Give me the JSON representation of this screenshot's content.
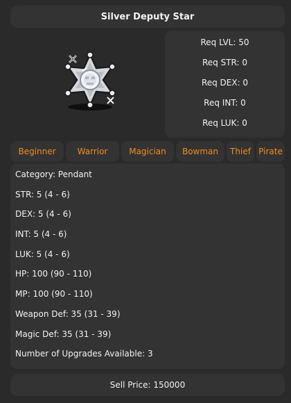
{
  "item": {
    "name": "Silver Deputy Star",
    "icon": "silver-star-badge-icon"
  },
  "requirements": [
    "Req LVL: 50",
    "Req STR: 0",
    "Req DEX: 0",
    "Req INT: 0",
    "Req LUK: 0"
  ],
  "jobs": [
    "Beginner",
    "Warrior",
    "Magician",
    "Bowman",
    "Thief",
    "Pirate"
  ],
  "stats": [
    "Category: Pendant",
    "STR: 5 (4 - 6)",
    "DEX: 5 (4 - 6)",
    "INT: 5 (4 - 6)",
    "LUK: 5 (4 - 6)",
    "HP: 100 (90 - 110)",
    "MP: 100 (90 - 110)",
    "Weapon Def: 35 (31 - 39)",
    "Magic Def: 35 (31 - 39)",
    "Number of Upgrades Available: 3"
  ],
  "sell_price": "Sell Price: 150000",
  "colors": {
    "background": "#2a2a2a",
    "panel": "#333333",
    "text": "#f2f2f2",
    "job_accent": "#f28b1e"
  }
}
